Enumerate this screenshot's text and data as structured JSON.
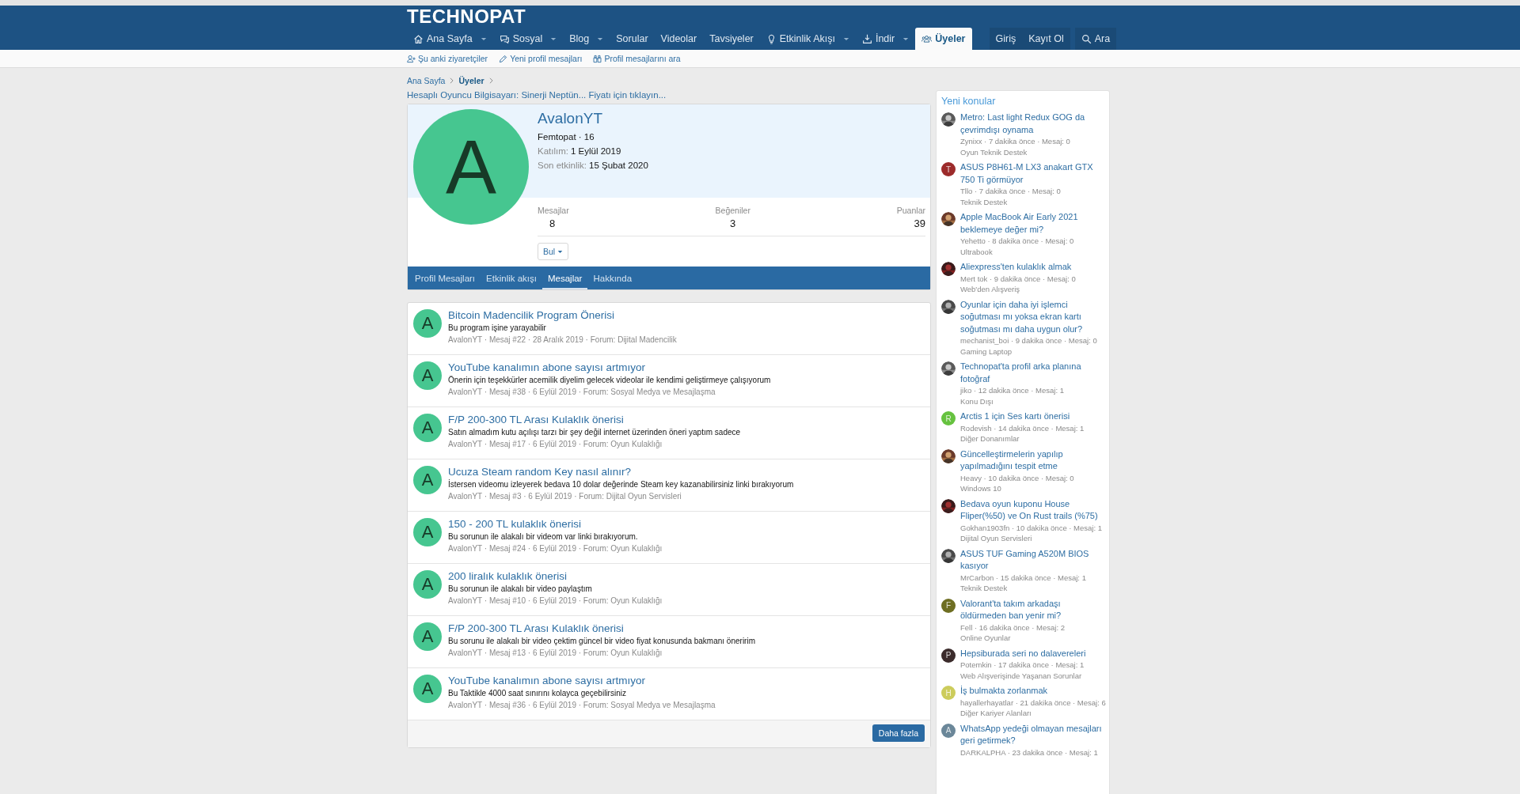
{
  "logo": "TECHNOPAT",
  "nav": [
    {
      "label": "Ana Sayfa",
      "caret": true,
      "selected": false
    },
    {
      "label": "Sosyal",
      "caret": true,
      "selected": false
    },
    {
      "label": "Blog",
      "caret": true,
      "selected": false
    },
    {
      "label": "Sorular",
      "caret": false,
      "selected": false
    },
    {
      "label": "Videolar",
      "caret": false,
      "selected": false
    },
    {
      "label": "Tavsiyeler",
      "caret": false,
      "selected": false
    },
    {
      "label": "Etkinlik Akışı",
      "caret": true,
      "selected": false
    },
    {
      "label": "İndir",
      "caret": true,
      "selected": false
    },
    {
      "label": "Üyeler",
      "caret": false,
      "selected": true
    }
  ],
  "account": [
    "Giriş",
    "Kayıt Ol"
  ],
  "search": "Ara",
  "subnav": [
    "Şu anki ziyaretçiler",
    "Yeni profil mesajları",
    "Profil mesajlarını ara"
  ],
  "breadcrumb": [
    "Ana Sayfa",
    "Üyeler"
  ],
  "notice": "Hesaplı Oyuncu Bilgisayarı: Sinerji Neptün... Fiyatı için tıklayın...",
  "profile": {
    "avatar_letter": "A",
    "name": "AvalonYT",
    "rank": "Femtopat · 16",
    "details": [
      {
        "label": "Katılım:",
        "value": "1 Eylül 2019"
      },
      {
        "label": "Son etkinlik:",
        "value": "15 Şubat 2020"
      }
    ],
    "stats": [
      {
        "label": "Mesajlar",
        "value": "8"
      },
      {
        "label": "Beğeniler",
        "value": "3"
      },
      {
        "label": "Puanlar",
        "value": "39"
      }
    ],
    "find_button": "Bul"
  },
  "tabs": [
    {
      "label": "Profil Mesajları",
      "selected": false
    },
    {
      "label": "Etkinlik akışı",
      "selected": false
    },
    {
      "label": "Mesajlar",
      "selected": true
    },
    {
      "label": "Hakkında",
      "selected": false
    }
  ],
  "messages": [
    {
      "avatar": "A",
      "title": "Bitcoin Madencilik Program Önerisi",
      "snippet": "Bu program işine yarayabilir",
      "meta": "AvalonYT · Mesaj #22 · 28 Aralık 2019 · Forum: Dijital Madencilik"
    },
    {
      "avatar": "A",
      "title": "YouTube kanalımın abone sayısı artmıyor",
      "snippet": "Önerin için teşekkürler acemilik diyelim gelecek videolar ile kendimi geliştirmeye çalışıyorum",
      "meta": "AvalonYT · Mesaj #38 · 6 Eylül 2019 · Forum: Sosyal Medya ve Mesajlaşma"
    },
    {
      "avatar": "A",
      "title": "F/P 200-300 TL Arası Kulaklık önerisi",
      "snippet": "Satın almadım kutu açılışı tarzı bir şey değil internet üzerinden öneri yaptım sadece",
      "meta": "AvalonYT · Mesaj #17 · 6 Eylül 2019 · Forum: Oyun Kulaklığı"
    },
    {
      "avatar": "A",
      "title": "Ucuza Steam random Key nasıl alınır?",
      "snippet": "İstersen videomu izleyerek bedava 10 dolar değerinde Steam key kazanabilirsiniz linki bırakıyorum",
      "meta": "AvalonYT · Mesaj #3 · 6 Eylül 2019 · Forum: Dijital Oyun Servisleri"
    },
    {
      "avatar": "A",
      "title": "150 - 200 TL kulaklık önerisi",
      "snippet": "Bu sorunun ile alakalı bir videom var linki bırakıyorum.",
      "meta": "AvalonYT · Mesaj #24 · 6 Eylül 2019 · Forum: Oyun Kulaklığı"
    },
    {
      "avatar": "A",
      "title": "200 liralık kulaklık önerisi",
      "snippet": "Bu sorunun ile alakalı bir video paylaştım",
      "meta": "AvalonYT · Mesaj #10 · 6 Eylül 2019 · Forum: Oyun Kulaklığı"
    },
    {
      "avatar": "A",
      "title": "F/P 200-300 TL Arası Kulaklık önerisi",
      "snippet": "Bu sorunu ile alakalı bir video çektim güncel bir video fiyat konusunda bakmanı öneririm",
      "meta": "AvalonYT · Mesaj #13 · 6 Eylül 2019 · Forum: Oyun Kulaklığı"
    },
    {
      "avatar": "A",
      "title": "YouTube kanalımın abone sayısı artmıyor",
      "snippet": "Bu Taktikle 4000 saat sınırını kolayca geçebilirsiniz",
      "meta": "AvalonYT · Mesaj #36 · 6 Eylül 2019 · Forum: Sosyal Medya ve Mesajlaşma"
    }
  ],
  "more_button": "Daha fazla",
  "sidebar": {
    "title": "Yeni konular",
    "items": [
      {
        "title": "Metro: Last light Redux GOG da çevrimdışı oynama",
        "meta": "Zynixx · 7 dakika önce · Mesaj: 0",
        "forum": "Oyun Teknik Destek"
      },
      {
        "avatar": {
          "kind": "letter",
          "letter": "T",
          "color": "#9c2b2b"
        },
        "title": "ASUS P8H61-M LX3 anakart GTX 750 Ti görmüyor",
        "meta": "Tllo · 7 dakika önce · Mesaj: 0",
        "forum": "Teknik Destek"
      },
      {
        "title": "Apple MacBook Air Early 2021 beklemeye değer mi?",
        "meta": "Yehetto · 8 dakika önce · Mesaj: 0",
        "forum": "Ultrabook"
      },
      {
        "title": "Aliexpress'ten kulaklık almak",
        "meta": "Mert tok · 9 dakika önce · Mesaj: 0",
        "forum": "Web'den Alışveriş"
      },
      {
        "title": "Oyunlar için daha iyi işlemci soğutması mı yoksa ekran kartı soğutması mı daha uygun olur?",
        "meta": "mechanist_boi · 9 dakika önce · Mesaj: 0",
        "forum": "Gaming Laptop"
      },
      {
        "title": "Technopat'ta profil arka planına fotoğraf",
        "meta": "jiko · 12 dakika önce · Mesaj: 1",
        "forum": "Konu Dışı"
      },
      {
        "avatar": {
          "kind": "letter",
          "letter": "R",
          "color": "#66c23f"
        },
        "title": "Arctis 1 için Ses kartı önerisi",
        "meta": "Rodevish · 14 dakika önce · Mesaj: 1",
        "forum": "Diğer Donanımlar"
      },
      {
        "title": "Güncelleştirmelerin yapılıp yapılmadığını tespit etme",
        "meta": "Heavy · 10 dakika önce · Mesaj: 0",
        "forum": "Windows 10"
      },
      {
        "title": "Bedava oyun kuponu House Fliper(%50) ve On Rust trails (%75)",
        "meta": "Gokhan1903fn · 10 dakika önce · Mesaj: 1",
        "forum": "Dijital Oyun Servisleri"
      },
      {
        "title": "ASUS TUF Gaming A520M BIOS kasıyor",
        "meta": "MrCarbon · 15 dakika önce · Mesaj: 1",
        "forum": "Teknik Destek"
      },
      {
        "avatar": {
          "kind": "letter",
          "letter": "F",
          "color": "#6e6e22"
        },
        "title": "Valorant'ta takım arkadaşı öldürmeden ban yenir mi?",
        "meta": "Fell · 16 dakika önce · Mesaj: 2",
        "forum": "Online Oyunlar"
      },
      {
        "avatar": {
          "kind": "letter",
          "letter": "P",
          "color": "#3b2b2b"
        },
        "title": "Hepsiburada seri no dalavereleri",
        "meta": "Potemkin · 17 dakika önce · Mesaj: 1",
        "forum": "Web Alışverişinde Yaşanan Sorunlar"
      },
      {
        "avatar": {
          "kind": "letter",
          "letter": "H",
          "color": "#cccc5c"
        },
        "title": "İş bulmakta zorlanmak",
        "meta": "hayallerhayatlar · 21 dakika önce · Mesaj: 6",
        "forum": "Diğer Kariyer Alanları"
      },
      {
        "avatar": {
          "kind": "letter",
          "letter": "A",
          "color": "#6b8799"
        },
        "title": "WhatsApp yedeği olmayan mesajları geri getirmek?",
        "meta": "DARKALPHA · 23 dakika önce · Mesaj: 1"
      }
    ]
  }
}
